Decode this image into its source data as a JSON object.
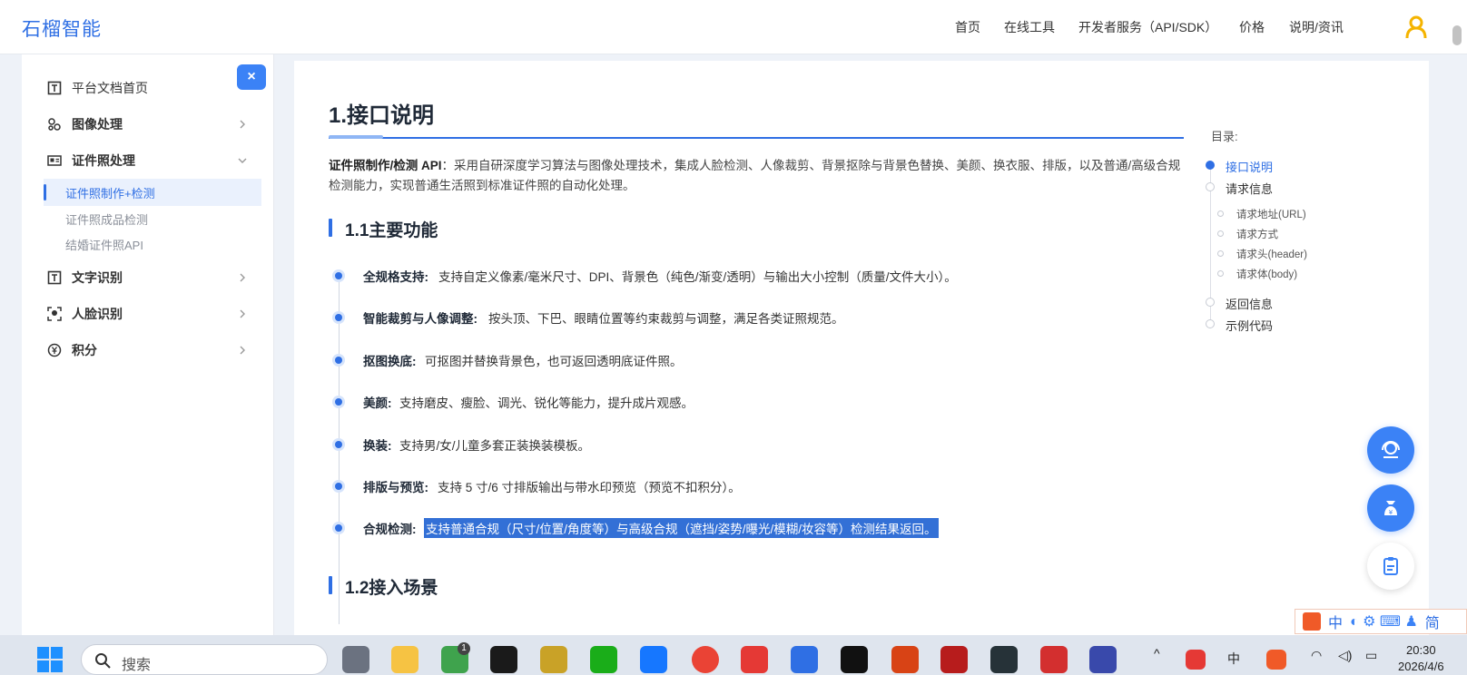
{
  "header": {
    "logo": "石榴智能",
    "nav": [
      "首页",
      "在线工具",
      "开发者服务（API/SDK）",
      "价格",
      "说明/资讯"
    ]
  },
  "sidebar": {
    "items": [
      {
        "label": "平台文档首页",
        "icon": "doc-t-icon"
      },
      {
        "label": "图像处理",
        "icon": "image-process-icon"
      },
      {
        "label": "证件照处理",
        "icon": "id-card-icon"
      },
      {
        "label": "文字识别",
        "icon": "text-icon"
      },
      {
        "label": "人脸识别",
        "icon": "face-icon"
      },
      {
        "label": "积分",
        "icon": "yen-icon"
      }
    ],
    "sub_items": [
      "证件照制作+检测",
      "证件照成品检测",
      "结婚证件照API"
    ],
    "close_label": "×"
  },
  "content": {
    "h1": "1.接口说明",
    "intro_bold": "证件照制作/检测 API",
    "intro_text": "：采用自研深度学习算法与图像处理技术，集成人脸检测、人像裁剪、背景抠除与背景色替换、美颜、换衣服、排版，以及普通/高级合规检测能力，实现普通生活照到标准证件照的自动化处理。",
    "h2_features": "1.1主要功能",
    "features": [
      {
        "name": "全规格支持:",
        "desc": "支持自定义像素/毫米尺寸、DPI、背景色（纯色/渐变/透明）与输出大小控制（质量/文件大小）。"
      },
      {
        "name": "智能裁剪与人像调整:",
        "desc": "按头顶、下巴、眼睛位置等约束裁剪与调整，满足各类证照规范。"
      },
      {
        "name": "抠图换底:",
        "desc": "可抠图并替换背景色，也可返回透明底证件照。"
      },
      {
        "name": "美颜:",
        "desc": "支持磨皮、瘦脸、调光、锐化等能力，提升成片观感。"
      },
      {
        "name": "换装:",
        "desc": "支持男/女/儿童多套正装换装模板。"
      },
      {
        "name": "排版与预览:",
        "desc": "支持 5 寸/6 寸排版输出与带水印预览（预览不扣积分）。"
      },
      {
        "name": "合规检测:",
        "desc": "支持普通合规（尺寸/位置/角度等）与高级合规（遮挡/姿势/曝光/模糊/妆容等）检测结果返回。"
      }
    ],
    "h2_scenes": "1.2接入场景"
  },
  "toc": {
    "title": "目录:",
    "items": [
      "接口说明",
      "请求信息",
      "返回信息",
      "示例代码"
    ],
    "sub_items": [
      "请求地址(URL)",
      "请求方式",
      "请求头(header)",
      "请求体(body)"
    ]
  },
  "ime": [
    "中",
    "简"
  ],
  "taskbar": {
    "search_placeholder": "搜索",
    "badge": "1",
    "ime_indicator": "中",
    "time": "20:30",
    "date": "2026/4/6"
  },
  "colors": {
    "accent": "#2f6fe4",
    "fab": "#3b82f6",
    "selection": "#3370d6"
  }
}
